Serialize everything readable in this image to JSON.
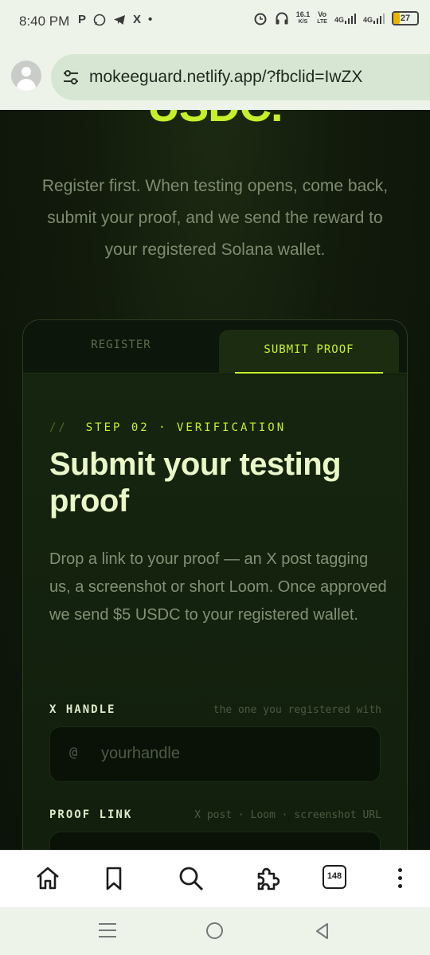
{
  "status_bar": {
    "time": "8:40 PM",
    "notification_icons": [
      "P",
      "whatsapp-icon",
      "telegram-icon",
      "X",
      "•"
    ],
    "net_speed": "16.1",
    "net_unit": "K/S",
    "volte_top": "Vo",
    "volte_bottom": "LTE",
    "signal1": "4G",
    "signal2": "4G",
    "battery": "27",
    "battery_level": 27
  },
  "address_bar": {
    "url": "mokeeguard.netlify.app/?fbclid=IwZX"
  },
  "page": {
    "hero_title": "USDC.",
    "lead": "Register first. When testing opens, come back, submit your proof, and we send the reward to your registered Solana wallet.",
    "tabs": [
      {
        "label": "REGISTER",
        "active": false
      },
      {
        "label": "SUBMIT PROOF",
        "active": true
      }
    ],
    "step_prefix": "//",
    "step_label": "STEP 02 · VERIFICATION",
    "heading": "Submit your testing proof",
    "description": "Drop a link to your proof — an X post tagging us, a screenshot or short Loom. Once approved we send $5 USDC to your registered wallet.",
    "fields": [
      {
        "label": "X HANDLE",
        "hint": "the one you registered with",
        "prefix": "@",
        "placeholder": "yourhandle"
      },
      {
        "label": "PROOF LINK",
        "hint": "X post · Loom · screenshot URL",
        "prefix": "",
        "placeholder": ""
      }
    ]
  },
  "bottom_nav": {
    "tab_count": "148"
  },
  "colors": {
    "accent": "#c6f02a",
    "page_bg": "#0c130a",
    "heading": "#eaf7c8"
  }
}
